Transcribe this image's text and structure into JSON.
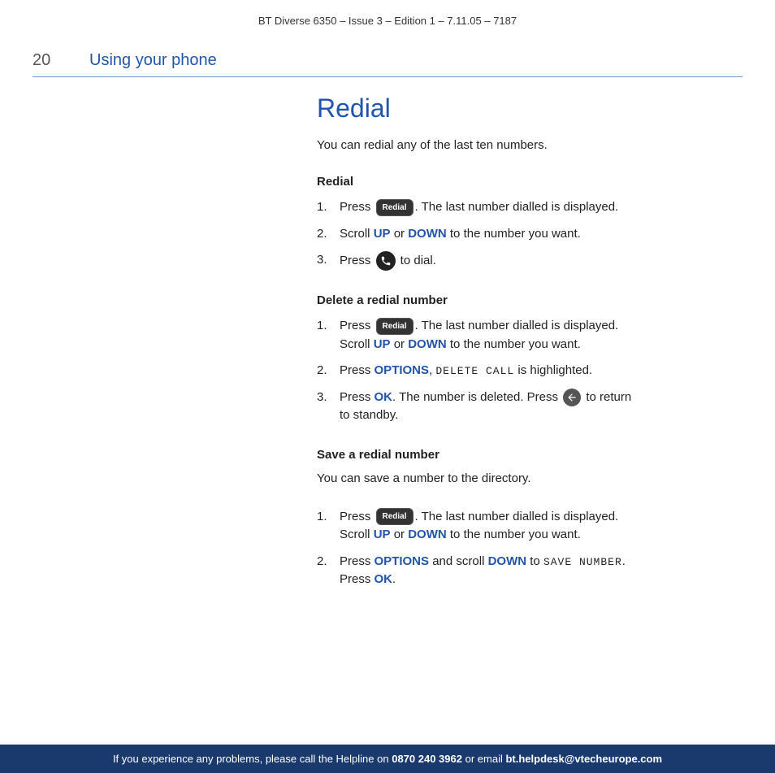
{
  "header": {
    "title": "BT Diverse 6350 – Issue 3 – Edition 1 – 7.11.05 – 7187"
  },
  "section": {
    "number": "20",
    "title": "Using your phone"
  },
  "main": {
    "page_title": "Redial",
    "intro": "You can redial any of the last ten numbers.",
    "subsections": [
      {
        "id": "redial",
        "title": "Redial",
        "steps": [
          {
            "num": "1.",
            "text_before": "Press",
            "button": "Redial",
            "text_after": ". The last number dialled is displayed."
          },
          {
            "num": "2.",
            "text_before": "Scroll",
            "highlight1": "UP",
            "mid": "or",
            "highlight2": "DOWN",
            "text_after": "to the number you want."
          },
          {
            "num": "3.",
            "text_before": "Press",
            "icon": "call",
            "text_after": "to dial."
          }
        ]
      },
      {
        "id": "delete",
        "title": "Delete a redial number",
        "steps": [
          {
            "num": "1.",
            "text_before": "Press",
            "button": "Redial",
            "text_after": ". The last number dialled is displayed. Scroll",
            "highlight1": "UP",
            "mid": "or",
            "highlight2": "DOWN",
            "text_after2": "to the number you want."
          },
          {
            "num": "2.",
            "text_before": "Press",
            "highlight1": "OPTIONS",
            "text_after": ", DELETE CALL is highlighted."
          },
          {
            "num": "3.",
            "text_before": "Press",
            "highlight1": "OK",
            "text_after": ". The number is deleted. Press",
            "icon": "return",
            "text_after2": "to return to standby."
          }
        ]
      },
      {
        "id": "save",
        "title": "Save a redial number",
        "intro": "You can save a number to the directory.",
        "steps": [
          {
            "num": "1.",
            "text_before": "Press",
            "button": "Redial",
            "text_after": ". The last number dialled is displayed. Scroll",
            "highlight1": "UP",
            "mid": "or",
            "highlight2": "DOWN",
            "text_after2": "to the number you want."
          },
          {
            "num": "2.",
            "text_before": "Press",
            "highlight1": "OPTIONS",
            "text_mid": "and scroll",
            "highlight2": "DOWN",
            "text_after": "to SAVE NUMBER. Press",
            "highlight3": "OK",
            "text_end": "."
          }
        ]
      }
    ]
  },
  "footer": {
    "text_before": "If you experience any problems, please call the Helpline on",
    "phone": "0870 240 3962",
    "text_mid": "or email",
    "email": "bt.helpdesk@vtecheurope.com"
  }
}
